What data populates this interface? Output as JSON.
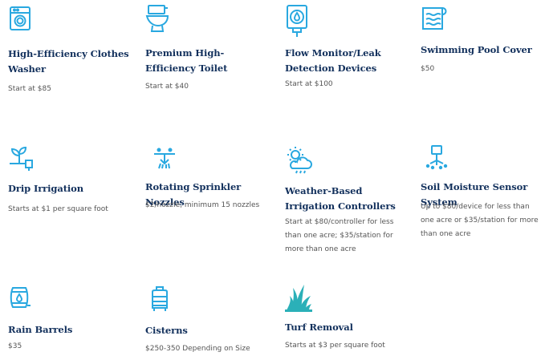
{
  "colors": {
    "icon": "#29a8e0",
    "title": "#12305c",
    "text": "#555555",
    "turf": "#2bb0b8"
  },
  "rebates": [
    {
      "id": "washer",
      "icon": "washing-machine-icon",
      "title": "High-Efficiency Clothes Washer",
      "price": "Start at $85"
    },
    {
      "id": "toilet",
      "icon": "toilet-icon",
      "title": "Premium High-Efficiency Toilet",
      "price": "Start at $40"
    },
    {
      "id": "flow-monitor",
      "icon": "leak-detector-icon",
      "title": "Flow Monitor/Leak Detection Devices",
      "price": "Start at $100"
    },
    {
      "id": "pool-cover",
      "icon": "pool-cover-icon",
      "title": "Swimming Pool Cover",
      "price": "$50"
    },
    {
      "id": "drip",
      "icon": "drip-irrigation-icon",
      "title": "Drip Irrigation",
      "price": "Starts at $1 per square foot"
    },
    {
      "id": "sprinkler",
      "icon": "sprinkler-icon",
      "title": "Rotating Sprinkler Nozzles",
      "price": "$2/nozzle, minimum 15 nozzles"
    },
    {
      "id": "weather",
      "icon": "weather-cloud-icon",
      "title": "Weather-Based Irrigation Controllers",
      "price": "Start at $80/controller for less than one acre; $35/station for more than one acre"
    },
    {
      "id": "soil",
      "icon": "soil-sensor-icon",
      "title": "Soil Moisture Sensor System",
      "price": "Up to $80/device for less than one acre or $35/station for more than one acre"
    },
    {
      "id": "rain-barrel",
      "icon": "rain-barrel-icon",
      "title": "Rain Barrels",
      "price": "$35"
    },
    {
      "id": "cistern",
      "icon": "cistern-icon",
      "title": "Cisterns",
      "price": "$250-350 Depending on Size"
    },
    {
      "id": "turf",
      "icon": "turf-grass-icon",
      "title": "Turf Removal",
      "price": "Starts at $3 per square foot"
    }
  ]
}
